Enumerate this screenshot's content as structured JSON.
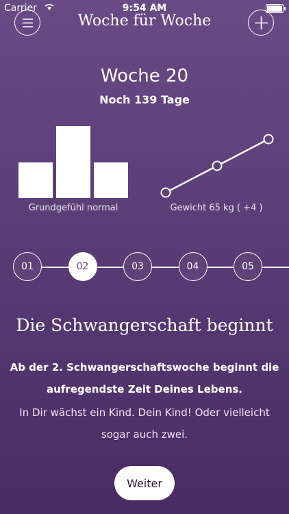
{
  "status_bar": {
    "carrier": "Carrier",
    "time": "9:54 AM"
  },
  "header": {
    "title": "Woche für Woche",
    "menu_icon": "menu-icon",
    "add_icon": "plus-icon"
  },
  "week": {
    "title": "Woche 20",
    "days_left": "Noch 139 Tage"
  },
  "mood": {
    "caption": "Grundgefühl normal"
  },
  "weight": {
    "caption": "Gewicht 65 kg ( +4 )"
  },
  "chart_data": [
    {
      "type": "bar",
      "values": [
        0.5,
        1.0,
        0.5
      ]
    },
    {
      "type": "line",
      "y": [
        0,
        1,
        2
      ]
    }
  ],
  "timeline": {
    "weeks": [
      "01",
      "02",
      "03",
      "04",
      "05"
    ],
    "active": "02"
  },
  "content": {
    "headline": "Die Schwangerschaft beginnt",
    "bold_text": "Ab der 2. Schwangerschaftswoche beginnt die aufregendste Zeit Deines Lebens.",
    "text": "In Dir wächst ein Kind. Dein Kind! Oder vielleicht sogar auch zwei."
  },
  "button": {
    "label": "Weiter"
  },
  "colors": {
    "background_top": "#6a4a85",
    "background_bottom": "#4a2b63",
    "foreground": "#ffffff"
  }
}
